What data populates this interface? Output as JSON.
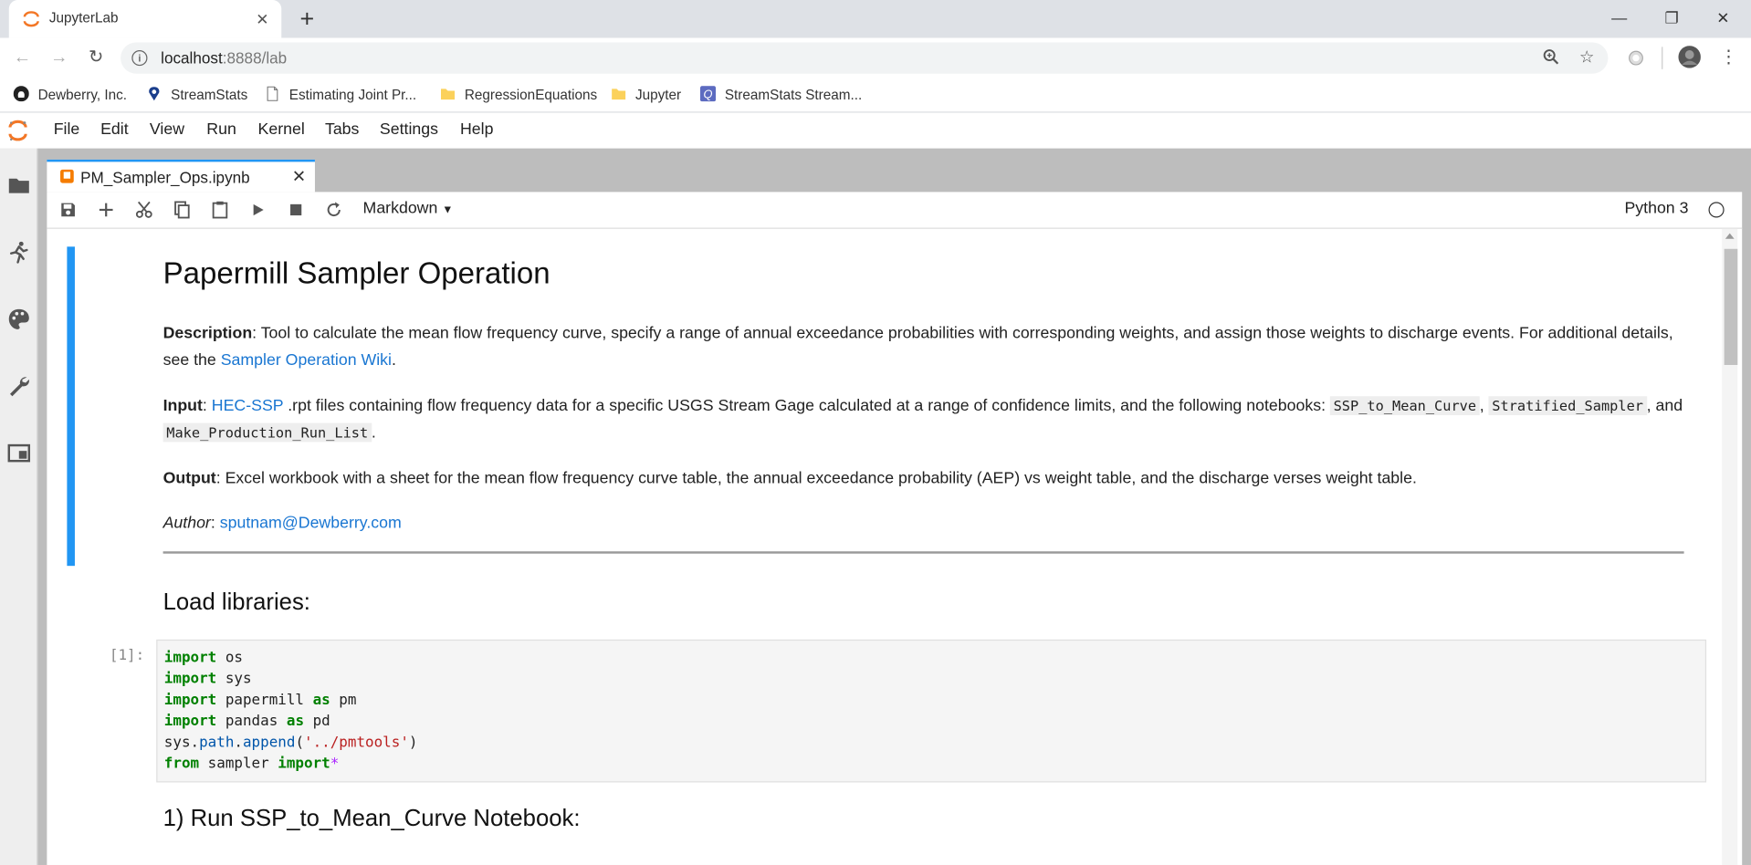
{
  "browser": {
    "tab_title": "JupyterLab",
    "url_host": "localhost",
    "url_rest": ":8888/lab",
    "bookmarks": [
      {
        "label": "Dewberry, Inc.",
        "icon": "github-icon"
      },
      {
        "label": "StreamStats",
        "icon": "map-pin-icon"
      },
      {
        "label": "Estimating Joint Pr...",
        "icon": "page-icon"
      },
      {
        "label": "RegressionEquations",
        "icon": "folder-icon"
      },
      {
        "label": "Jupyter",
        "icon": "folder-icon"
      },
      {
        "label": "StreamStats Stream...",
        "icon": "q-icon"
      }
    ]
  },
  "jupyter": {
    "menus": [
      "File",
      "Edit",
      "View",
      "Run",
      "Kernel",
      "Tabs",
      "Settings",
      "Help"
    ],
    "doc_tab": "PM_Sampler_Ops.ipynb",
    "cell_type": "Markdown",
    "kernel": "Python 3"
  },
  "notebook": {
    "title": "Papermill Sampler Operation",
    "description_label": "Description",
    "description_text": ": Tool to calculate the mean flow frequency curve, specify a range of annual exceedance probabilities with corresponding weights, and assign those weights to discharge events. For additional details, see the ",
    "description_link": "Sampler Operation Wiki",
    "description_end": ".",
    "input_label": "Input",
    "input_colon": ": ",
    "input_link": "HEC-SSP",
    "input_text": " .rpt files containing flow frequency data for a specific USGS Stream Gage calculated at a range of confidence limits, and the following notebooks: ",
    "input_code1": "SSP_to_Mean_Curve",
    "input_sep1": ",",
    "input_code2": "Stratified_Sampler",
    "input_sep2": ", and ",
    "input_code3": "Make_Production_Run_List",
    "input_end": ".",
    "output_label": "Output",
    "output_text": ": Excel workbook with a sheet for the mean flow frequency curve table, the annual exceedance probability (AEP) vs weight table, and the discharge verses weight table.",
    "author_label": "Author",
    "author_colon": ": ",
    "author_email": "sputnam@Dewberry.com",
    "section1": "Load libraries:",
    "prompt1": "[1]:",
    "section2": "1) Run SSP_to_Mean_Curve Notebook:"
  },
  "code_cell_1": [
    [
      {
        "t": "kw",
        "v": "import"
      },
      {
        "t": "n",
        "v": " os"
      }
    ],
    [
      {
        "t": "kw",
        "v": "import"
      },
      {
        "t": "n",
        "v": " sys"
      }
    ],
    [
      {
        "t": "kw",
        "v": "import"
      },
      {
        "t": "n",
        "v": " papermill "
      },
      {
        "t": "kw",
        "v": "as"
      },
      {
        "t": "n",
        "v": " pm"
      }
    ],
    [
      {
        "t": "kw",
        "v": "import"
      },
      {
        "t": "n",
        "v": " pandas "
      },
      {
        "t": "kw",
        "v": "as"
      },
      {
        "t": "n",
        "v": " pd"
      }
    ],
    [
      {
        "t": "n",
        "v": "sys."
      },
      {
        "t": "fn",
        "v": "path"
      },
      {
        "t": "n",
        "v": "."
      },
      {
        "t": "fn",
        "v": "append"
      },
      {
        "t": "n",
        "v": "("
      },
      {
        "t": "str",
        "v": "'../pmtools'"
      },
      {
        "t": "n",
        "v": ")"
      }
    ],
    [
      {
        "t": "kw",
        "v": "from"
      },
      {
        "t": "n",
        "v": " sampler "
      },
      {
        "t": "kw",
        "v": "import"
      },
      {
        "t": "op",
        "v": "*"
      }
    ]
  ],
  "colors": {
    "accent": "#2196f3",
    "link": "#1976d2",
    "jupyter_orange": "#f37726"
  }
}
